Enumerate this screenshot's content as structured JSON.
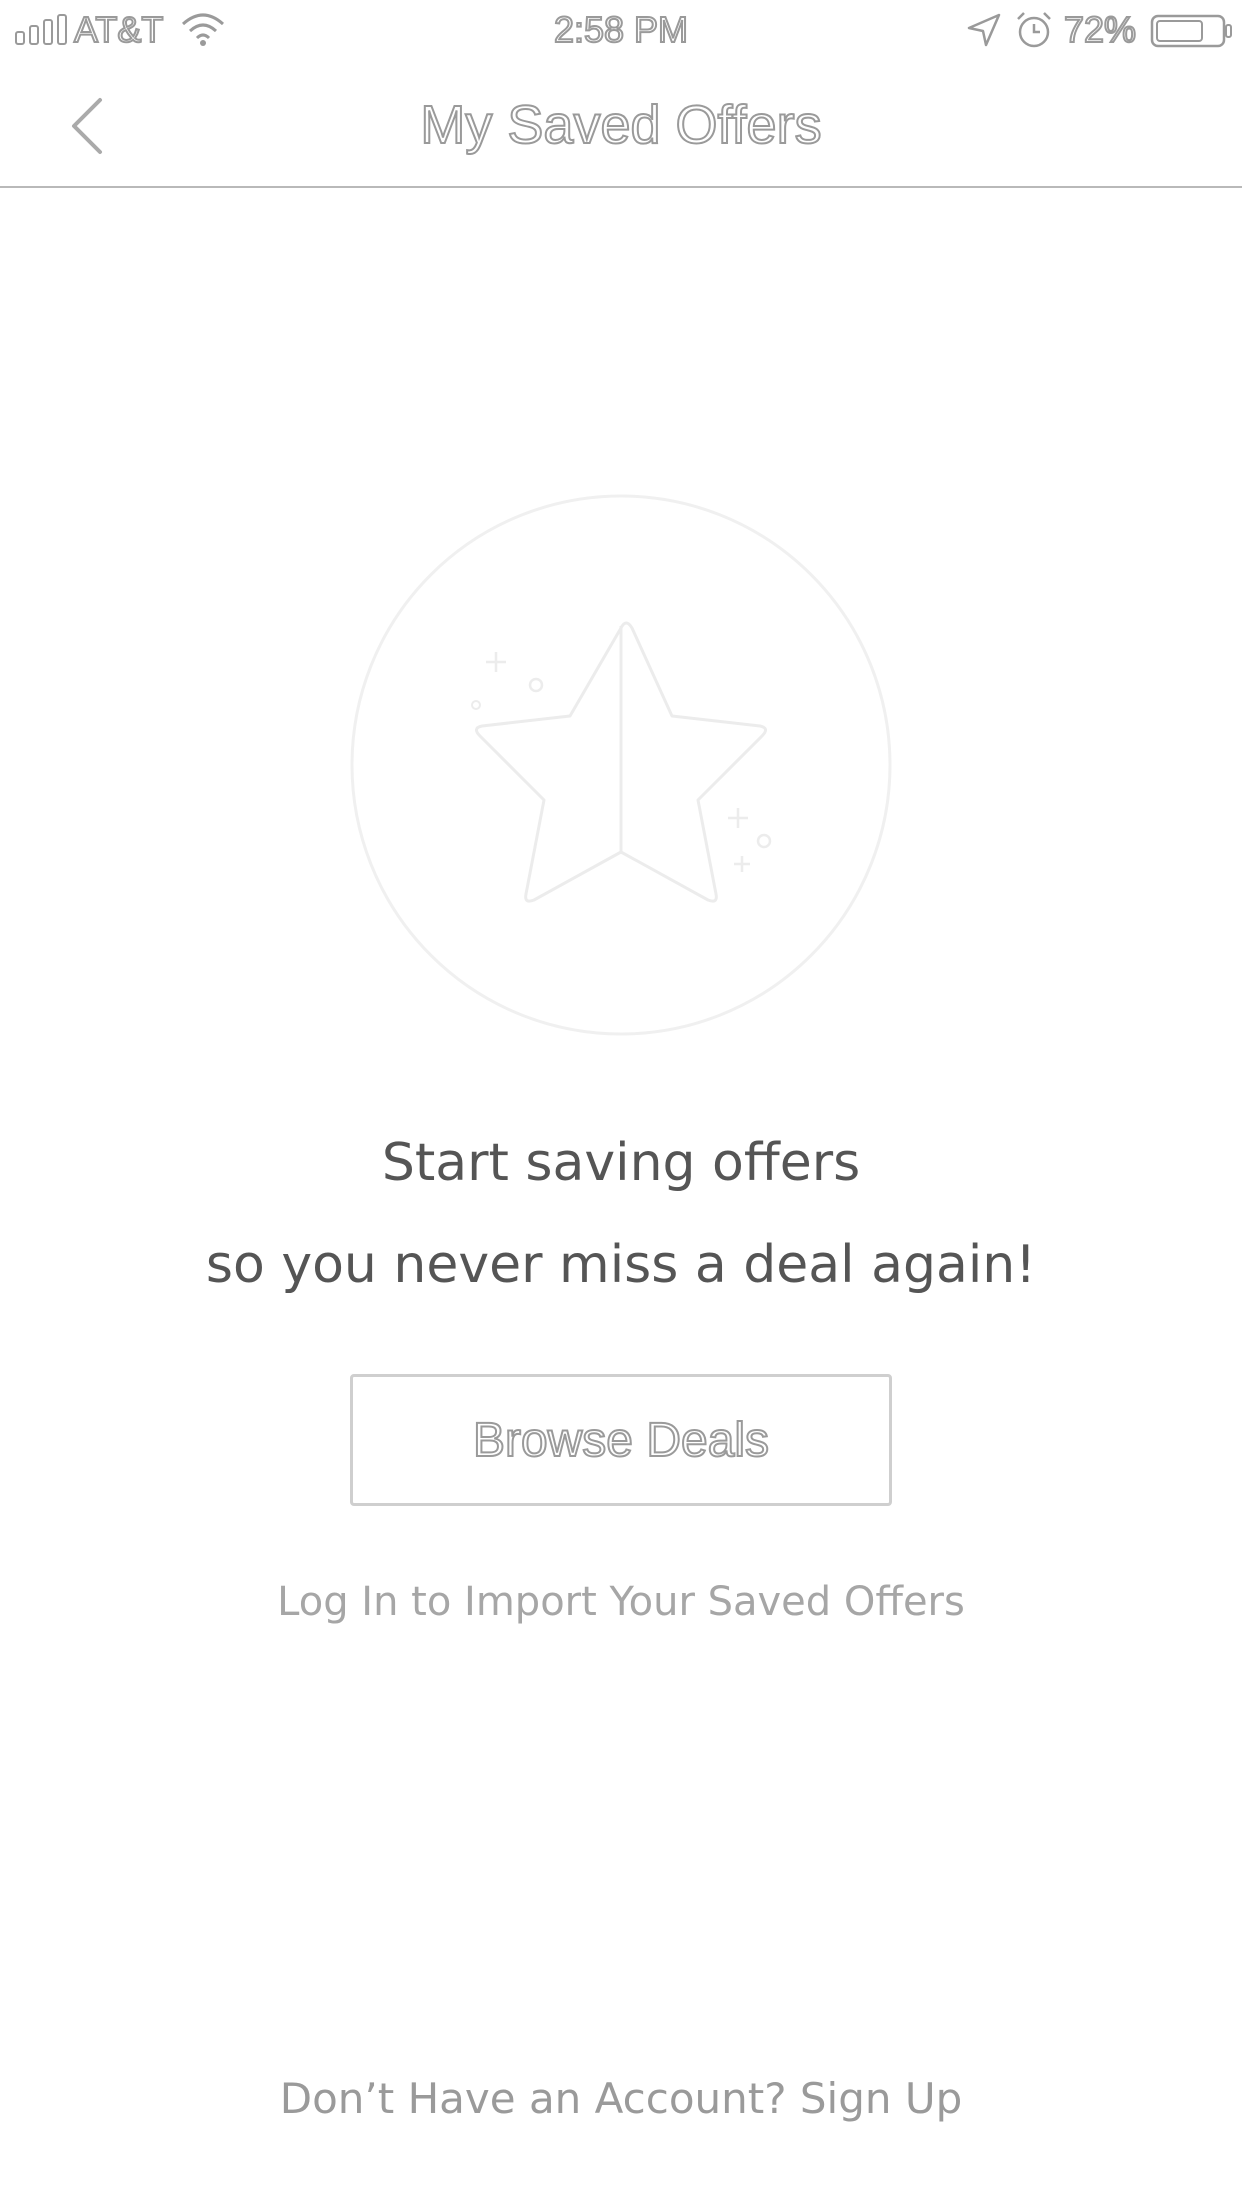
{
  "status_bar": {
    "carrier": "AT&T",
    "time": "2:58 PM",
    "battery_percent": "72%",
    "icons": [
      "signal-icon",
      "wifi-icon",
      "location-icon",
      "alarm-icon",
      "battery-icon"
    ]
  },
  "nav": {
    "title": "My Saved Offers",
    "back_icon": "chevron-left-icon"
  },
  "empty_state": {
    "illustration_icon": "star-icon",
    "headline_line1": "Start saving offers",
    "headline_line2": "so you never miss a deal again!",
    "browse_button_label": "Browse Deals",
    "login_link_label": "Log In to Import Your Saved Offers"
  },
  "footer": {
    "signup_prompt": "Don’t Have an Account? Sign Up"
  },
  "colors": {
    "background": "#ffffff",
    "text_primary": "#555555",
    "text_muted": "#a6a6a6",
    "divider": "#b9b9b9",
    "outline": "#9a9a9a"
  }
}
